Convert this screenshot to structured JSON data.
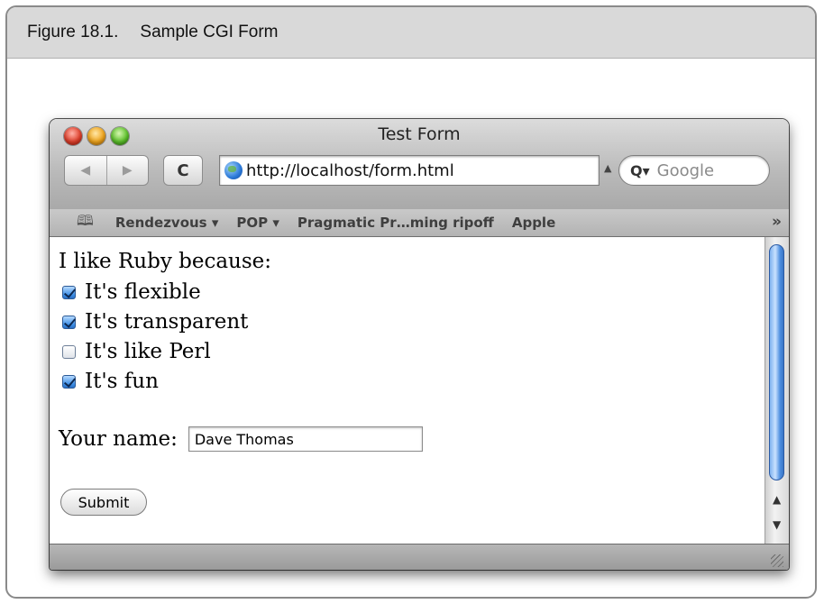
{
  "figure": {
    "number": "Figure 18.1.",
    "caption": "Sample CGI Form"
  },
  "window": {
    "title": "Test Form",
    "url": "http://localhost/form.html",
    "search_placeholder": "Google",
    "reload_glyph": "C",
    "bookmarks": [
      "Rendezvous ▾",
      "POP ▾",
      "Pragmatic Pr…ming ripoff",
      "Apple"
    ],
    "more_glyph": "»"
  },
  "form": {
    "intro": "I like Ruby because:",
    "options": [
      {
        "label": "It's flexible",
        "checked": true
      },
      {
        "label": "It's transparent",
        "checked": true
      },
      {
        "label": "It's like Perl",
        "checked": false
      },
      {
        "label": "It's fun",
        "checked": true
      }
    ],
    "name_label": "Your name:",
    "name_value": "Dave Thomas",
    "submit_label": "Submit"
  },
  "colors": {
    "checkbox_checked": "#3d8ee6",
    "scroll_thumb": "#4d8ee0"
  },
  "icons": {
    "close": "close-button-red",
    "minimize": "minimize-button-yellow",
    "zoom": "zoom-button-green",
    "back": "back-arrow-icon",
    "forward": "forward-arrow-icon",
    "reload": "reload-icon",
    "site": "globe-icon",
    "search": "magnifier-icon",
    "bookmarks": "book-icon"
  }
}
